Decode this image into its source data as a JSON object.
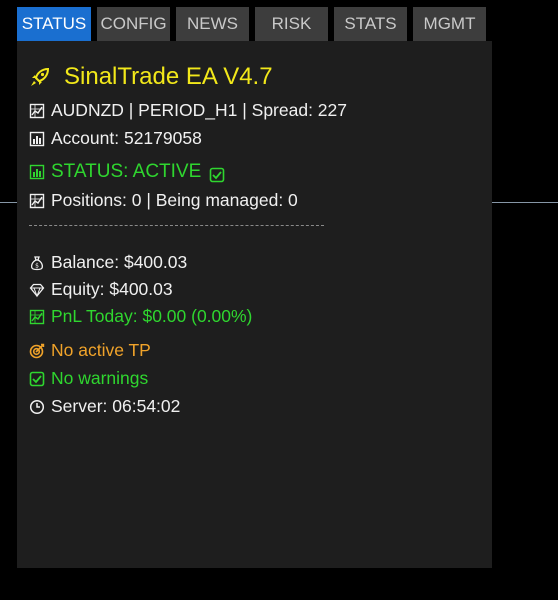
{
  "tabs": [
    {
      "label": "STATUS",
      "active": true
    },
    {
      "label": "CONFIG",
      "active": false
    },
    {
      "label": "NEWS",
      "active": false
    },
    {
      "label": "RISK",
      "active": false
    },
    {
      "label": "STATS",
      "active": false
    },
    {
      "label": "MGMT",
      "active": false
    }
  ],
  "colors": {
    "title": "#f2e81a",
    "text": "#f0f0f0",
    "active_green": "#2fd62f",
    "warning_orange": "#f0a32a",
    "tab_active": "#1a6fd0",
    "tab_inactive": "#3d3d3d",
    "panel_bg": "#1e1e1e"
  },
  "panel": {
    "title": "SinalTrade EA V4.7",
    "title_icon": "rocket-icon",
    "symbol_line": "AUDNZD | PERIOD_H1 | Spread: 227",
    "symbol_icon": "chart-icon",
    "account_line": "Account: 52179058",
    "account_icon": "bar-chart-icon",
    "status_line": "STATUS: ACTIVE",
    "status_icon": "bar-chart-icon",
    "status_check_icon": "checkbox-icon",
    "positions_line": "Positions: 0 | Being managed: 0",
    "positions_icon": "chart-icon",
    "balance_line": "Balance: $400.03",
    "balance_icon": "money-bag-icon",
    "equity_line": "Equity: $400.03",
    "equity_icon": "diamond-icon",
    "pnl_line": "PnL Today: $0.00 (0.00%)",
    "pnl_icon": "chart-icon",
    "tp_line": "No active TP",
    "tp_icon": "target-icon",
    "warnings_line": "No warnings",
    "warnings_icon": "checkbox-icon",
    "server_line": "Server: 06:54:02",
    "server_icon": "clock-icon"
  }
}
